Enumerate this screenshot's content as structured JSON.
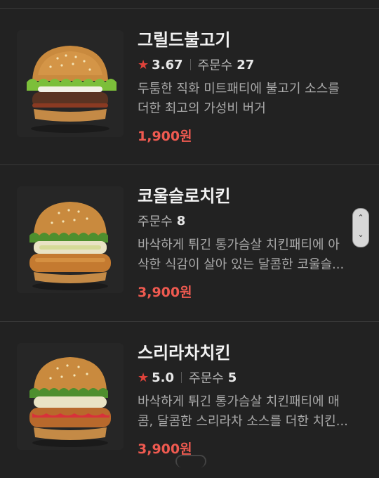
{
  "menu": {
    "items": [
      {
        "name": "그릴드불고기",
        "has_rating": true,
        "rating": "3.67",
        "order_label": "주문수",
        "order_count": "27",
        "description_line1": "두툼한 직화 미트패티에 불고기 소스를",
        "description_line2": "더한 최고의 가성비 버거",
        "price": "1,900원"
      },
      {
        "name": "코울슬로치킨",
        "has_rating": false,
        "rating": "",
        "order_label": "주문수",
        "order_count": "8",
        "description_line1": "바삭하게 튀긴 통가슴살 치킨패티에 아",
        "description_line2": "삭한 식감이 살아 있는 달콤한 코울슬...",
        "price": "3,900원"
      },
      {
        "name": "스리라차치킨",
        "has_rating": true,
        "rating": "5.0",
        "order_label": "주문수",
        "order_count": "5",
        "description_line1": "바삭하게 튀긴 통가슴살 치킨패티에 매",
        "description_line2": "콤, 달콤한 스리라차 소스를 더한 치킨...",
        "price": "3,900원"
      }
    ]
  },
  "colors": {
    "background": "#222222",
    "price": "#ef5a50",
    "star": "#e0423a"
  },
  "icons": {
    "rating": "star-icon",
    "scroll_up": "chevron-up-icon",
    "scroll_down": "chevron-down-icon"
  }
}
